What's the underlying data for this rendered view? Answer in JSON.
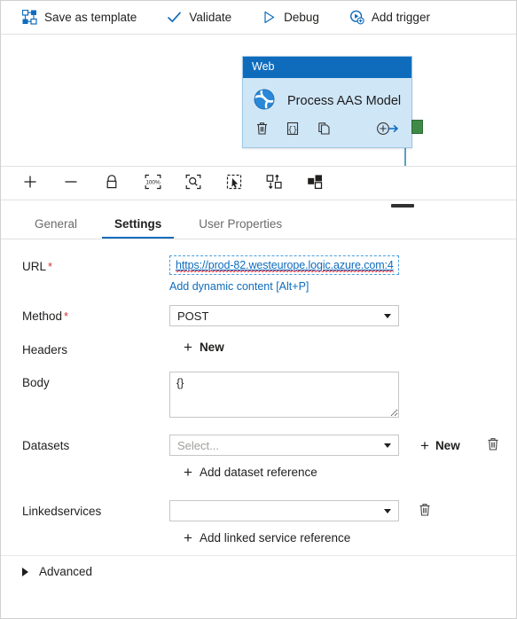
{
  "command_bar": {
    "items": [
      {
        "label": "Save as template",
        "icon": "save-template-icon"
      },
      {
        "label": "Validate",
        "icon": "checkmark-icon"
      },
      {
        "label": "Debug",
        "icon": "play-triangle-icon"
      },
      {
        "label": "Add trigger",
        "icon": "add-trigger-icon"
      }
    ]
  },
  "canvas": {
    "annotation": {
      "shape": "red-circle"
    },
    "activity_card": {
      "type_label": "Web",
      "title": "Process AAS Model",
      "icon": "web-globe-icon",
      "actions": [
        {
          "name": "delete-activity",
          "icon": "trash-icon"
        },
        {
          "name": "view-code",
          "icon": "code-braces-icon"
        },
        {
          "name": "clone-activity",
          "icon": "copy-icon"
        },
        {
          "name": "add-output-connection",
          "icon": "add-arrow-icon"
        }
      ],
      "connector": {
        "name": "success-connector",
        "color": "#3f8a46"
      }
    }
  },
  "canvas_toolbar": {
    "buttons": [
      {
        "name": "zoom-in",
        "icon": "plus-icon"
      },
      {
        "name": "zoom-out",
        "icon": "minus-icon"
      },
      {
        "name": "lock-canvas",
        "icon": "lock-icon"
      },
      {
        "name": "zoom-to-100",
        "icon": "zoom-100-percent-icon",
        "label": "100%"
      },
      {
        "name": "zoom-to-fit",
        "icon": "zoom-fit-icon"
      },
      {
        "name": "select-region",
        "icon": "select-cursor-icon"
      },
      {
        "name": "auto-align",
        "icon": "auto-align-icon"
      },
      {
        "name": "toggle-minimap",
        "icon": "minimap-icon"
      }
    ]
  },
  "panel": {
    "collapse_handle": "panel-collapse-handle",
    "tabs": [
      {
        "label": "General",
        "active": false
      },
      {
        "label": "Settings",
        "active": true
      },
      {
        "label": "User Properties",
        "active": false
      }
    ]
  },
  "form": {
    "url": {
      "label": "URL",
      "required": "*",
      "value": "https://prod-82.westeurope.logic.azure.com:4",
      "dynamic_content_link": "Add dynamic content [Alt+P]"
    },
    "method": {
      "label": "Method",
      "required": "*",
      "value": "POST"
    },
    "headers": {
      "label": "Headers",
      "new_label": "New"
    },
    "body": {
      "label": "Body",
      "value": "{}"
    },
    "datasets": {
      "label": "Datasets",
      "placeholder": "Select...",
      "new_label": "New",
      "add_reference_label": "Add dataset reference",
      "delete_icon": "trash-icon"
    },
    "linkedservices": {
      "label": "Linkedservices",
      "value": "",
      "add_reference_label": "Add linked service reference",
      "delete_icon": "trash-icon"
    },
    "advanced": {
      "label": "Advanced"
    }
  },
  "colors": {
    "accent": "#0f6cbd",
    "card_header": "#0f6cbd",
    "card_body": "#cfe6f7",
    "required_red": "#d13438",
    "annotation_red": "#e81123",
    "connector_green": "#3f8a46"
  }
}
